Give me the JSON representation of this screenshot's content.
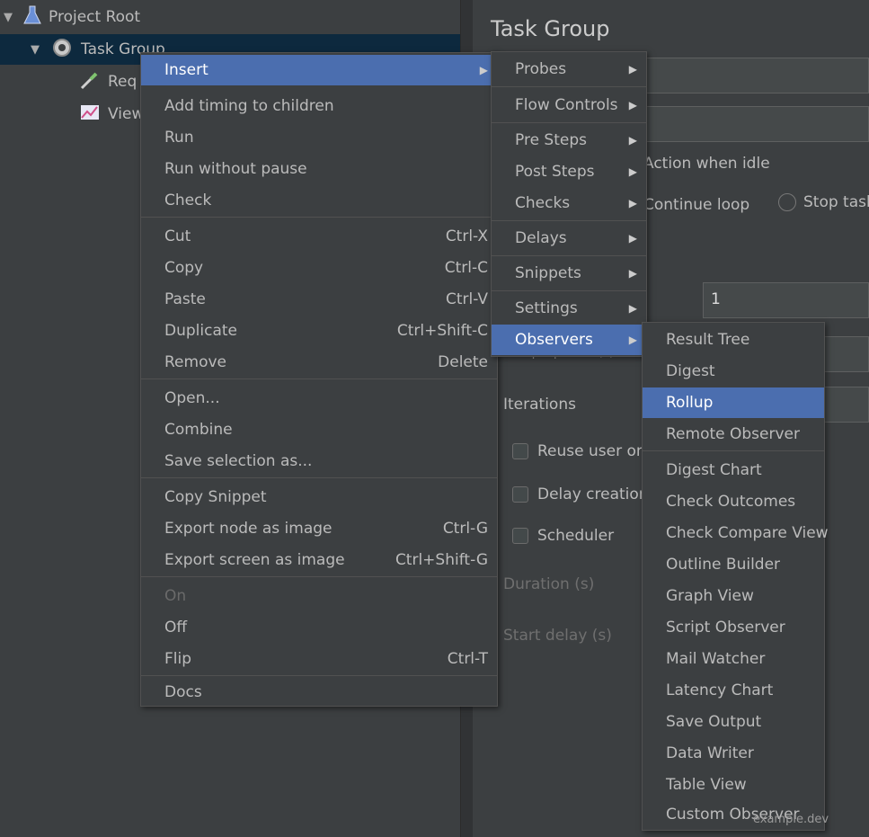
{
  "tree": {
    "root": "Project Root",
    "group": "Task Group",
    "child1": "Req",
    "child2": "View"
  },
  "panel": {
    "title": "Task Group",
    "action_label": "Action when idle",
    "radio1": "Continue loop",
    "radio2": "Stop task",
    "count_value": "1",
    "ramp_label": "Ramp-Up time (s)",
    "loop_label": "Iterations",
    "same_user_label": "Reuse user on",
    "delay_label": "Delay creation",
    "scheduler_label": "Scheduler",
    "duration_label": "Duration (s)",
    "startup_label": "Start delay (s)"
  },
  "menu1": {
    "items": [
      {
        "label": "Insert",
        "shortcut": ""
      },
      {
        "label": "Add timing to children",
        "shortcut": ""
      },
      {
        "label": "Run",
        "shortcut": ""
      },
      {
        "label": "Run without pause",
        "shortcut": ""
      },
      {
        "label": "Check",
        "shortcut": ""
      },
      {
        "label": "Cut",
        "shortcut": "Ctrl-X"
      },
      {
        "label": "Copy",
        "shortcut": "Ctrl-C"
      },
      {
        "label": "Paste",
        "shortcut": "Ctrl-V"
      },
      {
        "label": "Duplicate",
        "shortcut": "Ctrl+Shift-C"
      },
      {
        "label": "Remove",
        "shortcut": "Delete"
      },
      {
        "label": "Open...",
        "shortcut": ""
      },
      {
        "label": "Combine",
        "shortcut": ""
      },
      {
        "label": "Save selection as...",
        "shortcut": ""
      },
      {
        "label": "Copy Snippet",
        "shortcut": ""
      },
      {
        "label": "Export node as image",
        "shortcut": "Ctrl-G"
      },
      {
        "label": "Export screen as image",
        "shortcut": "Ctrl+Shift-G"
      },
      {
        "label": "On",
        "shortcut": ""
      },
      {
        "label": "Off",
        "shortcut": ""
      },
      {
        "label": "Flip",
        "shortcut": "Ctrl-T"
      },
      {
        "label": "Docs",
        "shortcut": ""
      }
    ]
  },
  "menu2": {
    "items": [
      {
        "label": "Probes"
      },
      {
        "label": "Flow Controls"
      },
      {
        "label": "Pre Steps"
      },
      {
        "label": "Post Steps"
      },
      {
        "label": "Checks"
      },
      {
        "label": "Delays"
      },
      {
        "label": "Snippets"
      },
      {
        "label": "Settings"
      },
      {
        "label": "Observers"
      }
    ]
  },
  "menu3": {
    "items": [
      {
        "label": "Result Tree"
      },
      {
        "label": "Digest"
      },
      {
        "label": "Rollup"
      },
      {
        "label": "Remote Observer"
      },
      {
        "label": "Digest Chart"
      },
      {
        "label": "Check Outcomes"
      },
      {
        "label": "Check Compare View"
      },
      {
        "label": "Outline Builder"
      },
      {
        "label": "Graph View"
      },
      {
        "label": "Script Observer"
      },
      {
        "label": "Mail Watcher"
      },
      {
        "label": "Latency Chart"
      },
      {
        "label": "Save Output"
      },
      {
        "label": "Data Writer"
      },
      {
        "label": "Table View"
      },
      {
        "label": "Custom Observer"
      }
    ]
  },
  "watermark": "example.dev"
}
